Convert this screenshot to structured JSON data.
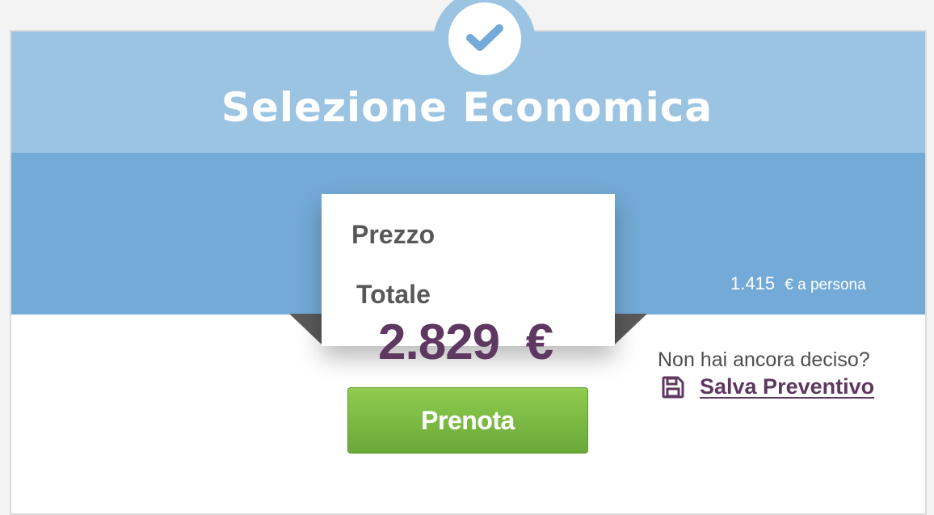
{
  "header": {
    "title": "Selezione Economica",
    "icon": "check-icon"
  },
  "price_box": {
    "prezzo_label": "Prezzo",
    "totale_label": "Totale",
    "total_price": "2.829  €"
  },
  "per_person": {
    "amount": "1.415",
    "suffix": "€ a persona"
  },
  "actions": {
    "book_label": "Prenota",
    "undecided_text": "Non hai ancora deciso?",
    "save_label": "Salva Preventivo",
    "save_icon": "floppy-disk-icon"
  },
  "colors": {
    "header_light": "#9bc3e2",
    "header_dark": "#74aad7",
    "price_purple": "#5e3860",
    "button_green": "#7dba44"
  }
}
